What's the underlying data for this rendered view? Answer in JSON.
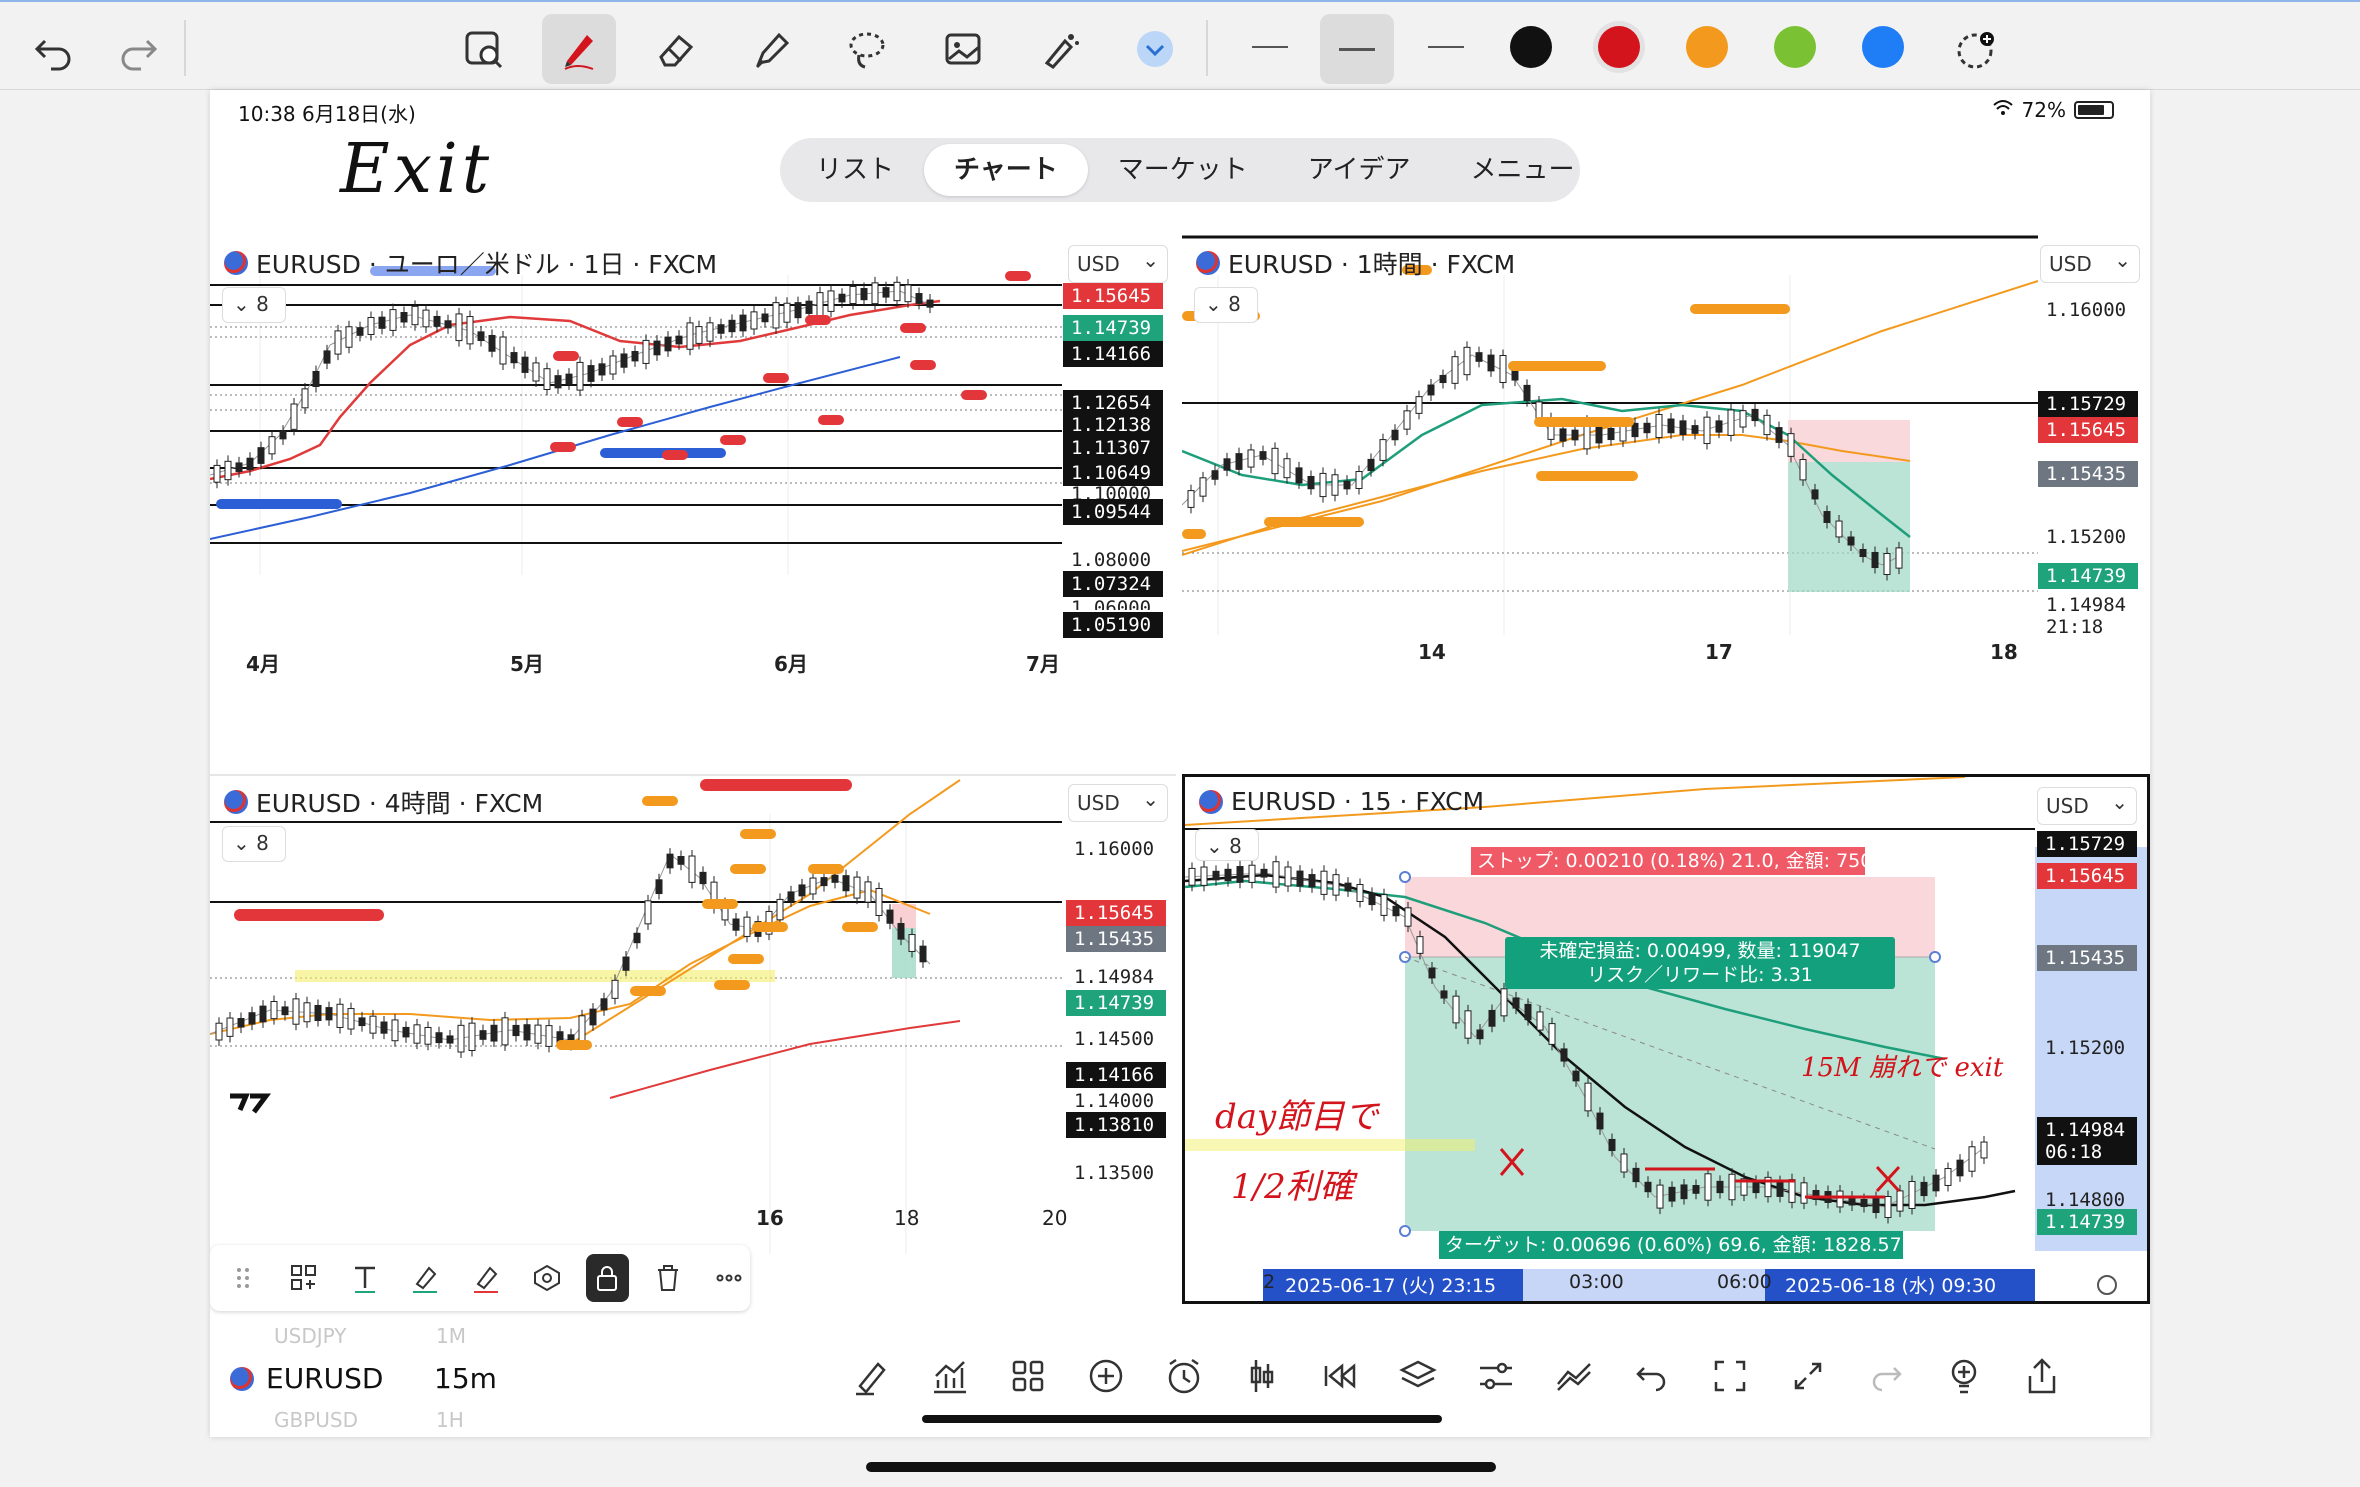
{
  "toolbar": {
    "icons": [
      "undo-icon",
      "redo-icon",
      "zoom-image-icon",
      "pen-icon",
      "eraser-icon",
      "highlighter-icon",
      "lasso-icon",
      "image-icon",
      "laser-icon",
      "chevron-down-icon"
    ],
    "colors": [
      "#111111",
      "#d3141c",
      "#f39a1e",
      "#7ac234",
      "#1f7ef5"
    ]
  },
  "status": {
    "time": "10:38   6月18日(水)",
    "battery": "72%"
  },
  "annotation_exit": "Exit",
  "tabs": [
    "リスト",
    "チャート",
    "マーケット",
    "アイデア",
    "メニュー"
  ],
  "active_tab": "チャート",
  "panels": {
    "daily": {
      "title": "EURUSD · ユーロ／米ドル · 1日 · FXCM",
      "currency": "USD",
      "chip": "8",
      "prices": [
        {
          "v": "1.15645",
          "s": "red"
        },
        {
          "v": "1.14739",
          "s": "green"
        },
        {
          "v": "1.14166",
          "s": "black"
        },
        {
          "v": "1.12654",
          "s": "black"
        },
        {
          "v": "1.12138",
          "s": "black"
        },
        {
          "v": "1.11307",
          "s": "black"
        },
        {
          "v": "1.10649",
          "s": "black"
        },
        {
          "v": "1.10000",
          "s": "plain"
        },
        {
          "v": "1.09544",
          "s": "black"
        },
        {
          "v": "1.08000",
          "s": "plain"
        },
        {
          "v": "1.07324",
          "s": "black"
        },
        {
          "v": "1.06000",
          "s": "plain"
        },
        {
          "v": "1.05190",
          "s": "black"
        }
      ],
      "xlabels": [
        "4月",
        "5月",
        "6月",
        "7月"
      ]
    },
    "hourly": {
      "title": "EURUSD · 1時間 · FXCM",
      "currency": "USD",
      "chip": "8",
      "prices": [
        {
          "v": "1.16000",
          "s": "plain"
        },
        {
          "v": "1.15729",
          "s": "black"
        },
        {
          "v": "1.15645",
          "s": "red"
        },
        {
          "v": "1.15435",
          "s": "gray"
        },
        {
          "v": "1.15200",
          "s": "plain"
        },
        {
          "v": "1.14984",
          "s": "plain"
        },
        {
          "v": "21:18",
          "s": "plain"
        },
        {
          "v": "1.14739",
          "s": "green"
        }
      ],
      "xlabels": [
        "14",
        "17",
        "18"
      ]
    },
    "h4": {
      "title": "EURUSD · 4時間 · FXCM",
      "currency": "USD",
      "chip": "8",
      "prices": [
        {
          "v": "1.16000",
          "s": "plain"
        },
        {
          "v": "1.15645",
          "s": "red"
        },
        {
          "v": "1.15435",
          "s": "gray"
        },
        {
          "v": "1.14984",
          "s": "plain"
        },
        {
          "v": "1.14739",
          "s": "green"
        },
        {
          "v": "1.14500",
          "s": "plain"
        },
        {
          "v": "1.14166",
          "s": "black"
        },
        {
          "v": "1.14000",
          "s": "plain"
        },
        {
          "v": "1.13810",
          "s": "black"
        },
        {
          "v": "1.13500",
          "s": "plain"
        }
      ],
      "xlabels": [
        "16",
        "18",
        "20"
      ]
    },
    "m15": {
      "title": "EURUSD · 15 · FXCM",
      "currency": "USD",
      "chip": "8",
      "prices": [
        {
          "v": "1.15729",
          "s": "black"
        },
        {
          "v": "1.15645",
          "s": "red"
        },
        {
          "v": "1.15435",
          "s": "gray"
        },
        {
          "v": "1.15200",
          "s": "plain"
        },
        {
          "v": "1.14984",
          "s": "black"
        },
        {
          "v": "06:18",
          "s": "black"
        },
        {
          "v": "1.14800",
          "s": "plain"
        },
        {
          "v": "1.14739",
          "s": "green"
        }
      ],
      "stop_label": "ストップ: 0.00210 (0.18%) 21.0, 金額: 750",
      "pnl_label_1": "未確定損益: 0.00499, 数量: 119047",
      "pnl_label_2": "リスク／リワード比: 3.31",
      "target_label": "ターゲット: 0.00696 (0.60%) 69.6, 金額: 1828.57",
      "note_right": "15M 崩れで exit",
      "note_left_1": "day節目で",
      "note_left_2": "1/2利確",
      "time_left": "2025-06-17 (火)  23:15",
      "time_mid1": "03:00",
      "time_mid2": "06:00",
      "time_right": "2025-06-18 (水)  09:30",
      "xlabel_start": "2"
    }
  },
  "bottom": {
    "symbol": "EURUSD",
    "interval": "15m",
    "ghost_top": "USDJPY",
    "ghost_top_tf": "1M",
    "ghost_bottom": "GBPUSD",
    "ghost_bottom_tf": "1H"
  }
}
